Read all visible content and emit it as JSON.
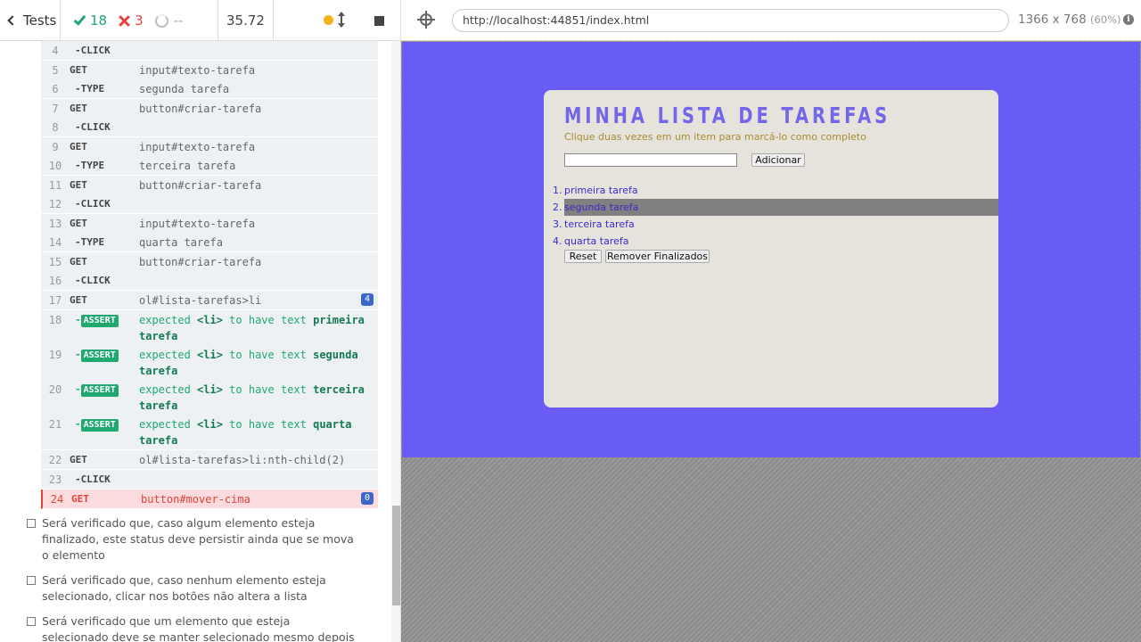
{
  "runner": {
    "tests_label": "Tests",
    "passed": "18",
    "failed": "3",
    "pending": "--",
    "duration": "35.72"
  },
  "commands": [
    {
      "num": "4",
      "name": "-CLICK",
      "msg": ""
    },
    {
      "num": "5",
      "name": "GET",
      "msg": "input#texto-tarefa"
    },
    {
      "num": "6",
      "name": "-TYPE",
      "msg": "segunda tarefa"
    },
    {
      "num": "7",
      "name": "GET",
      "msg": "button#criar-tarefa"
    },
    {
      "num": "8",
      "name": "-CLICK",
      "msg": ""
    },
    {
      "num": "9",
      "name": "GET",
      "msg": "input#texto-tarefa"
    },
    {
      "num": "10",
      "name": "-TYPE",
      "msg": "terceira tarefa"
    },
    {
      "num": "11",
      "name": "GET",
      "msg": "button#criar-tarefa"
    },
    {
      "num": "12",
      "name": "-CLICK",
      "msg": ""
    },
    {
      "num": "13",
      "name": "GET",
      "msg": "input#texto-tarefa"
    },
    {
      "num": "14",
      "name": "-TYPE",
      "msg": "quarta tarefa"
    },
    {
      "num": "15",
      "name": "GET",
      "msg": "button#criar-tarefa"
    },
    {
      "num": "16",
      "name": "-CLICK",
      "msg": ""
    },
    {
      "num": "17",
      "name": "GET",
      "msg": "ol#lista-tarefas>li",
      "badge": "4"
    },
    {
      "num": "18",
      "name": "ASSERT",
      "msg_pre": "expected",
      "msg_el": "<li>",
      "msg_mid": "to have text",
      "msg_val": "primeira tarefa"
    },
    {
      "num": "19",
      "name": "ASSERT",
      "msg_pre": "expected",
      "msg_el": "<li>",
      "msg_mid": "to have text",
      "msg_val": "segunda tarefa"
    },
    {
      "num": "20",
      "name": "ASSERT",
      "msg_pre": "expected",
      "msg_el": "<li>",
      "msg_mid": "to have text",
      "msg_val": "terceira tarefa"
    },
    {
      "num": "21",
      "name": "ASSERT",
      "msg_pre": "expected",
      "msg_el": "<li>",
      "msg_mid": "to have text",
      "msg_val": "quarta tarefa"
    },
    {
      "num": "22",
      "name": "GET",
      "msg": "ol#lista-tarefas>li:nth-child(2)"
    },
    {
      "num": "23",
      "name": "-CLICK",
      "msg": ""
    },
    {
      "num": "24",
      "name": "GET",
      "msg": "button#mover-cima",
      "badge": "0"
    }
  ],
  "tests": [
    "Será verificado que, caso algum elemento esteja finalizado, este status deve persistir ainda que se mova o elemento",
    "Será verificado que, caso nenhum elemento esteja selecionado, clicar nos botões não altera a lista",
    "Será verificado que um elemento que esteja selecionado deve se manter selecionado mesmo depois de movido"
  ],
  "browser": {
    "url": "http://localhost:44851/index.html",
    "viewport": "1366 x 768",
    "zoom": "(60%)",
    "info_glyph": "i"
  },
  "app": {
    "title": "MINHA LISTA DE TAREFAS",
    "subtitle": "Clique duas vezes em um item para marcá-lo como completo",
    "add_label": "Adicionar",
    "reset_label": "Reset",
    "remove_label": "Remover Finalizados",
    "tasks": [
      {
        "n": "1.",
        "text": "primeira tarefa"
      },
      {
        "n": "2.",
        "text": "segunda tarefa"
      },
      {
        "n": "3.",
        "text": "terceira tarefa"
      },
      {
        "n": "4.",
        "text": "quarta tarefa"
      }
    ]
  }
}
